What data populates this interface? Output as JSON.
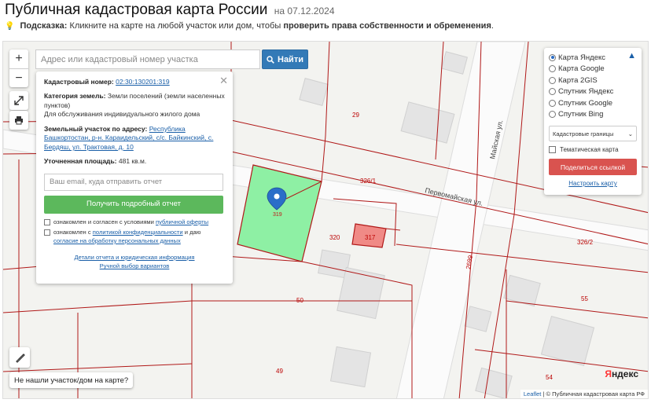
{
  "header": {
    "title": "Публичная кадастровая карта России",
    "date": "на 07.12.2024"
  },
  "hint": {
    "label": "Подсказка:",
    "text": "Кликните на карте на любой участок или дом, чтобы",
    "bold": "проверить права собственности и обременения",
    "end": "."
  },
  "search": {
    "placeholder": "Адрес или кадастровый номер участка",
    "button_label": "Найти"
  },
  "card": {
    "cadastral_label": "Кадастровый номер:",
    "cadastral_number": "02:30:130201:319",
    "category_label": "Категория земель:",
    "category_value": "Земли поселений (земли населенных пунктов)",
    "usage": "Для обслуживания индивидуального жилого дома",
    "address_label": "Земельный участок по адресу:",
    "address_value": "Республика Башкортостан, р-н. Караидельский, с/с. Байкинский, с. Бердяш, ул. Трактовая, д. 10",
    "area_label": "Уточненная площадь:",
    "area_value": "481 кв.м.",
    "email_placeholder": "Ваш email, куда отправить отчет",
    "report_button": "Получить подробный отчет",
    "consent1_text": "ознакомлен и согласен с условиями",
    "consent1_link": "публичной оферты",
    "consent2_text": "ознакомлен с",
    "consent2_link": "политикой конфиденциальности",
    "consent2_and": "и даю",
    "consent2_link2": "согласие на обработку персональных данных",
    "footer_link1": "Детали отчета и юридическая информация",
    "footer_link2": "Ручной выбор вариантов"
  },
  "layers": {
    "options": [
      {
        "label": "Карта Яндекс",
        "selected": true
      },
      {
        "label": "Карта Google",
        "selected": false
      },
      {
        "label": "Карта 2GIS",
        "selected": false
      },
      {
        "label": "Спутник Яндекс",
        "selected": false
      },
      {
        "label": "Спутник Google",
        "selected": false
      },
      {
        "label": "Спутник Bing",
        "selected": false
      }
    ],
    "select_value": "Кадастровые границы",
    "thematic_label": "Тематическая карта",
    "share_button": "Поделиться ссылкой",
    "configure_link": "Настроить карту"
  },
  "buttons": {
    "zoom_in": "+",
    "zoom_out": "−",
    "not_found": "Не нашли участок/дом на карте?"
  },
  "map": {
    "marker_label": "319",
    "parcel_labels": [
      "29",
      "326/1",
      "320",
      "317",
      "326/2",
      "50",
      "55",
      "49",
      "54",
      "2699"
    ],
    "street_labels": [
      "Первомайская ул.",
      "Майская ул."
    ],
    "yandex_logo_a": "Я",
    "yandex_logo_b": "ндекс",
    "attribution_leaflet": "Leaflet",
    "attribution_text": "| © Публичная кадастровая карта РФ"
  },
  "colors": {
    "selected_parcel": "#8ef0a4",
    "parcel_317": "#f08a86",
    "boundary": "#b01818",
    "search_button": "#337ab7",
    "report_button": "#5cb85c",
    "share_button": "#d9534f"
  }
}
